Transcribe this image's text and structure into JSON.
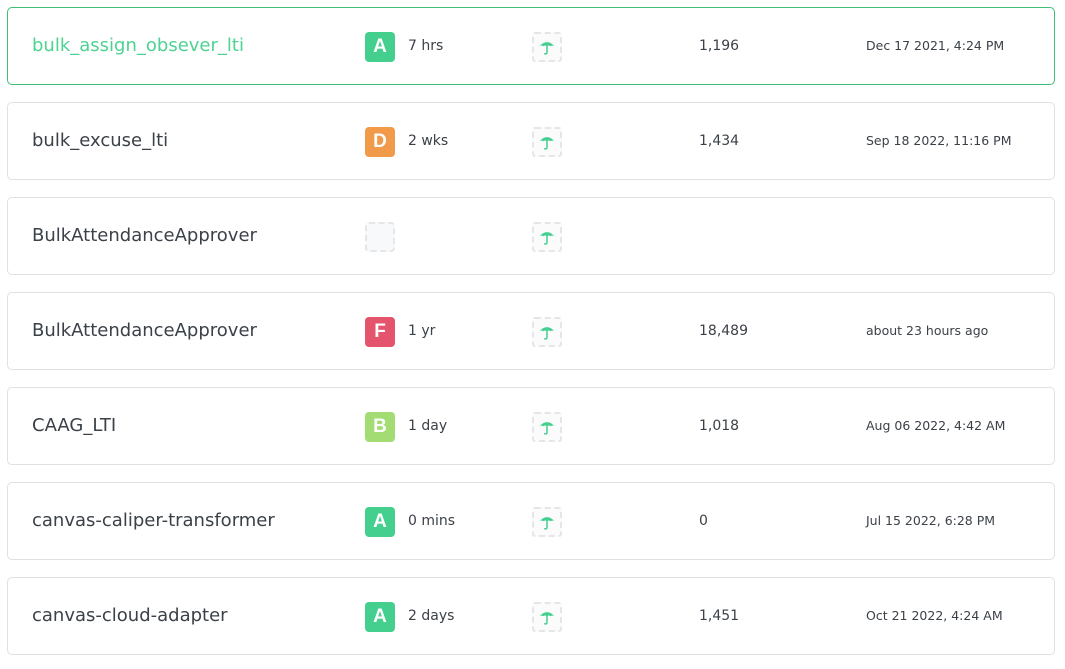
{
  "colors": {
    "active_border": "#3fbf7a",
    "active_name": "#4dd391",
    "grade_A": "#45cf8f",
    "grade_B": "#a2dc72",
    "grade_D": "#f09a4a",
    "grade_F": "#e5546d",
    "coverage_icon": "#45cf8f"
  },
  "repos": [
    {
      "name": "bulk_assign_obsever_lti",
      "grade": "A",
      "maintainability": "7 hrs",
      "coverage_icon": "umbrella-icon",
      "loc": "1,196",
      "updated": "Dec 17 2021, 4:24 PM",
      "active": true
    },
    {
      "name": "bulk_excuse_lti",
      "grade": "D",
      "maintainability": "2 wks",
      "coverage_icon": "umbrella-icon",
      "loc": "1,434",
      "updated": "Sep 18 2022, 11:16 PM",
      "active": false
    },
    {
      "name": "BulkAttendanceApprover",
      "grade": "",
      "maintainability": "",
      "coverage_icon": "umbrella-icon",
      "loc": "",
      "updated": "",
      "active": false
    },
    {
      "name": "BulkAttendanceApprover",
      "grade": "F",
      "maintainability": "1 yr",
      "coverage_icon": "umbrella-icon",
      "loc": "18,489",
      "updated": "about 23 hours ago",
      "active": false
    },
    {
      "name": "CAAG_LTI",
      "grade": "B",
      "maintainability": "1 day",
      "coverage_icon": "umbrella-icon",
      "loc": "1,018",
      "updated": "Aug 06 2022, 4:42 AM",
      "active": false
    },
    {
      "name": "canvas-caliper-transformer",
      "grade": "A",
      "maintainability": "0 mins",
      "coverage_icon": "umbrella-icon",
      "loc": "0",
      "updated": "Jul 15 2022, 6:28 PM",
      "active": false
    },
    {
      "name": "canvas-cloud-adapter",
      "grade": "A",
      "maintainability": "2 days",
      "coverage_icon": "umbrella-icon",
      "loc": "1,451",
      "updated": "Oct 21 2022, 4:24 AM",
      "active": false
    }
  ]
}
